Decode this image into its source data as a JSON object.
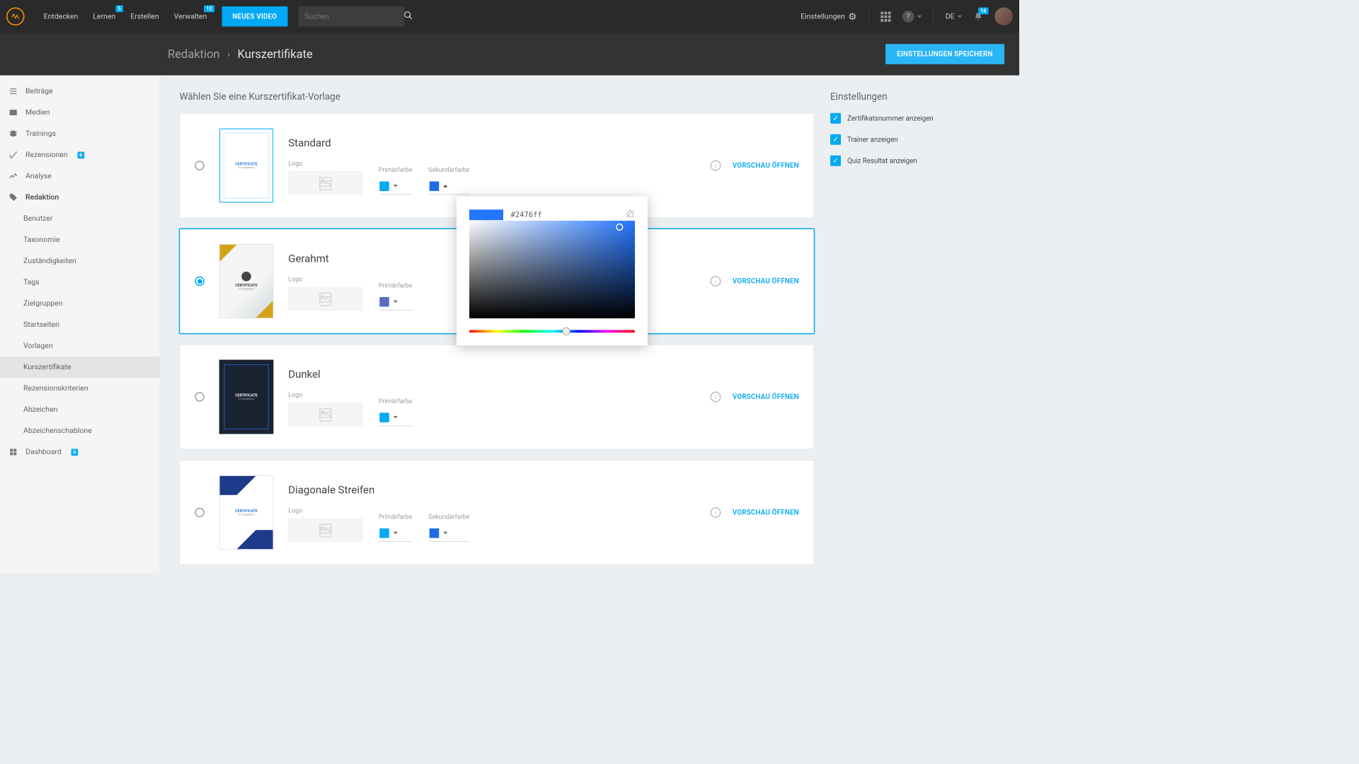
{
  "nav": {
    "items": [
      {
        "label": "Entdecken",
        "badge": null
      },
      {
        "label": "Lernen",
        "badge": "5"
      },
      {
        "label": "Erstellen",
        "badge": null
      },
      {
        "label": "Verwalten",
        "badge": "12"
      }
    ],
    "new_video": "NEUES VIDEO",
    "search_ph": "Suchen",
    "settings": "Einstellungen",
    "lang": "DE",
    "notif": "16"
  },
  "crumb": {
    "root": "Redaktion",
    "curr": "Kurszertifikate",
    "save": "EINSTELLUNGEN SPEICHERN"
  },
  "side": [
    {
      "label": "Beiträge",
      "icon": "list",
      "sub": false
    },
    {
      "label": "Medien",
      "icon": "media",
      "sub": false
    },
    {
      "label": "Trainings",
      "icon": "cap",
      "sub": false
    },
    {
      "label": "Rezensionen",
      "icon": "check",
      "sub": false,
      "badge": "6"
    },
    {
      "label": "Analyse",
      "icon": "chart",
      "sub": false
    },
    {
      "label": "Redaktion",
      "icon": "tag",
      "sub": false,
      "bold": true
    },
    {
      "label": "Benutzer",
      "sub": true
    },
    {
      "label": "Taxonomie",
      "sub": true
    },
    {
      "label": "Zuständigkeiten",
      "sub": true
    },
    {
      "label": "Tags",
      "sub": true
    },
    {
      "label": "Zielgruppen",
      "sub": true
    },
    {
      "label": "Startseiten",
      "sub": true
    },
    {
      "label": "Vorlagen",
      "sub": true
    },
    {
      "label": "Kurszertifikate",
      "sub": true,
      "active": true
    },
    {
      "label": "Rezensionskriterien",
      "sub": true
    },
    {
      "label": "Abzeichen",
      "sub": true
    },
    {
      "label": "Abzeichenschablone",
      "sub": true
    },
    {
      "label": "Dashboard",
      "icon": "dash",
      "sub": false,
      "badge": "6"
    }
  ],
  "page_title": "Wählen Sie eine Kurszertifikat-Vorlage",
  "labels": {
    "logo": "Logo",
    "primary": "Primärfarbe",
    "secondary": "Sekundärfarbe",
    "preview": "VORSCHAU ÖFFNEN"
  },
  "templates": [
    {
      "name": "Standard",
      "selected": false,
      "primary": "#03a9f4",
      "secondary": "#1e6be6",
      "thumb": "t-std"
    },
    {
      "name": "Gerahmt",
      "selected": true,
      "primary": "#5c6bc0",
      "secondary": null,
      "thumb": "t-fr"
    },
    {
      "name": "Dunkel",
      "selected": false,
      "primary": "#03a9f4",
      "secondary": null,
      "thumb": "t-dark"
    },
    {
      "name": "Diagonale Streifen",
      "selected": false,
      "primary": "#03a9f4",
      "secondary": "#1e6be6",
      "thumb": "t-diag"
    }
  ],
  "picker": {
    "hex": "#2476ff",
    "swatch": "#2476ff"
  },
  "settings_panel": {
    "title": "Einstellungen",
    "items": [
      {
        "label": "Zertifikatsnummer anzeigen",
        "checked": true
      },
      {
        "label": "Trainer anzeigen",
        "checked": true
      },
      {
        "label": "Quiz Resultat anzeigen",
        "checked": true
      }
    ]
  }
}
